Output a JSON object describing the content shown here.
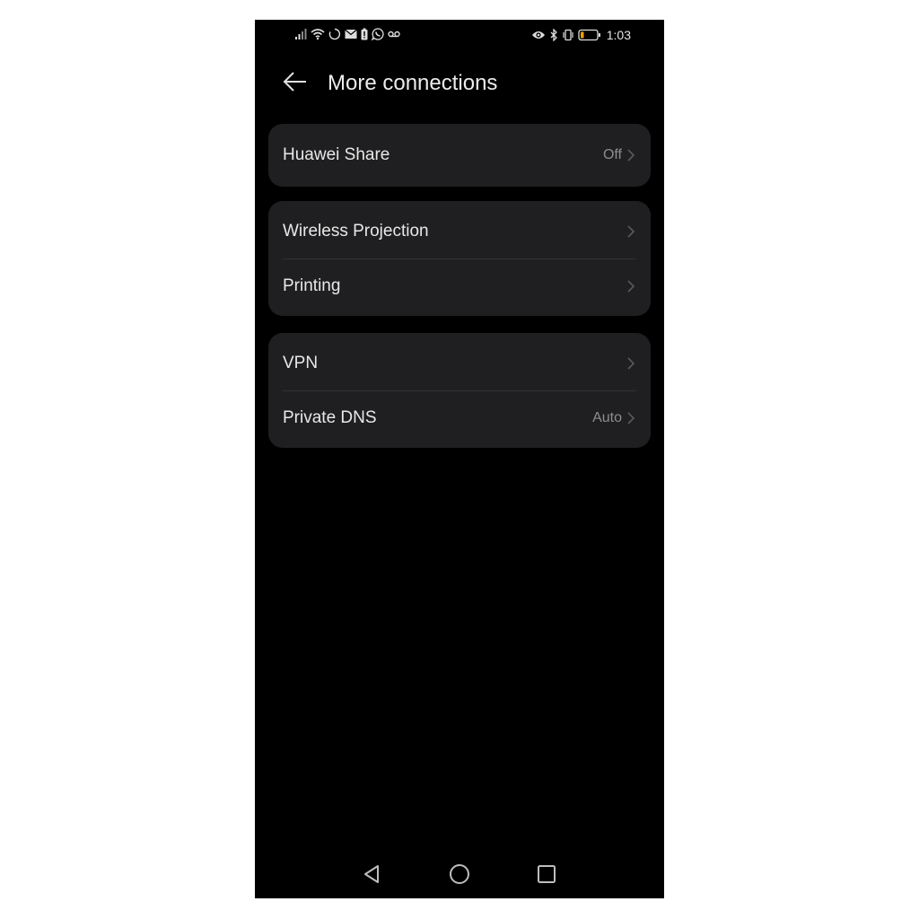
{
  "status_bar": {
    "left_icons": [
      "signal-icon",
      "wifi-icon",
      "sync-icon",
      "mail-icon",
      "battery-alert-icon",
      "whatsapp-icon",
      "voicemail-icon"
    ],
    "right_icons": [
      "eye-icon",
      "bluetooth-icon",
      "vibrate-icon",
      "battery-icon"
    ],
    "battery_level_percent": 15,
    "battery_color": "#f0a000",
    "time": "1:03"
  },
  "header": {
    "title": "More connections",
    "back_icon": "arrow-left-icon"
  },
  "groups": [
    {
      "items": [
        {
          "label": "Huawei Share",
          "value": "Off"
        }
      ]
    },
    {
      "items": [
        {
          "label": "Wireless Projection",
          "value": ""
        },
        {
          "label": "Printing",
          "value": ""
        }
      ]
    },
    {
      "items": [
        {
          "label": "VPN",
          "value": ""
        },
        {
          "label": "Private DNS",
          "value": "Auto"
        }
      ]
    }
  ],
  "navbar": {
    "buttons": [
      "back-triangle-icon",
      "home-circle-icon",
      "recents-square-icon"
    ]
  },
  "colors": {
    "background": "#000000",
    "card": "#1f1f21",
    "text_primary": "#e8e8e8",
    "text_secondary": "#8d8d8f"
  }
}
